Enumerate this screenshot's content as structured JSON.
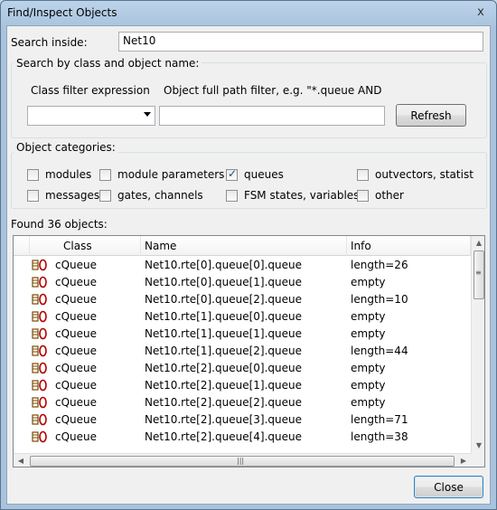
{
  "window": {
    "title": "Find/Inspect Objects",
    "close_glyph": "x"
  },
  "search_inside": {
    "label": "Search inside:",
    "value": "Net10"
  },
  "search_group": {
    "title": "Search by class and object name:",
    "class_filter_label": "Class filter expression",
    "class_filter_value": "",
    "path_filter_label": "Object full path filter, e.g. \"*.queue AND",
    "path_filter_value": "",
    "refresh_label": "Refresh"
  },
  "categories": {
    "title": "Object categories:",
    "items": [
      {
        "label": "modules",
        "checked": false
      },
      {
        "label": "module parameters",
        "checked": false
      },
      {
        "label": "queues",
        "checked": true
      },
      {
        "label": "outvectors, statist",
        "checked": false
      },
      {
        "label": "messages",
        "checked": false
      },
      {
        "label": "gates, channels",
        "checked": false
      },
      {
        "label": "FSM states, variables",
        "checked": false
      },
      {
        "label": "other",
        "checked": false
      }
    ]
  },
  "results": {
    "found_label": "Found 36 objects:",
    "columns": [
      "Class",
      "Name",
      "Info"
    ],
    "icon": "queue-icon",
    "rows": [
      {
        "class": "cQueue",
        "name": "Net10.rte[0].queue[0].queue",
        "info": "length=26"
      },
      {
        "class": "cQueue",
        "name": "Net10.rte[0].queue[1].queue",
        "info": "empty"
      },
      {
        "class": "cQueue",
        "name": "Net10.rte[0].queue[2].queue",
        "info": "length=10"
      },
      {
        "class": "cQueue",
        "name": "Net10.rte[1].queue[0].queue",
        "info": "empty"
      },
      {
        "class": "cQueue",
        "name": "Net10.rte[1].queue[1].queue",
        "info": "empty"
      },
      {
        "class": "cQueue",
        "name": "Net10.rte[1].queue[2].queue",
        "info": "length=44"
      },
      {
        "class": "cQueue",
        "name": "Net10.rte[2].queue[0].queue",
        "info": "empty"
      },
      {
        "class": "cQueue",
        "name": "Net10.rte[2].queue[1].queue",
        "info": "empty"
      },
      {
        "class": "cQueue",
        "name": "Net10.rte[2].queue[2].queue",
        "info": "empty"
      },
      {
        "class": "cQueue",
        "name": "Net10.rte[2].queue[3].queue",
        "info": "length=71"
      },
      {
        "class": "cQueue",
        "name": "Net10.rte[2].queue[4].queue",
        "info": "length=38"
      }
    ]
  },
  "close_button": {
    "label": "Close"
  }
}
